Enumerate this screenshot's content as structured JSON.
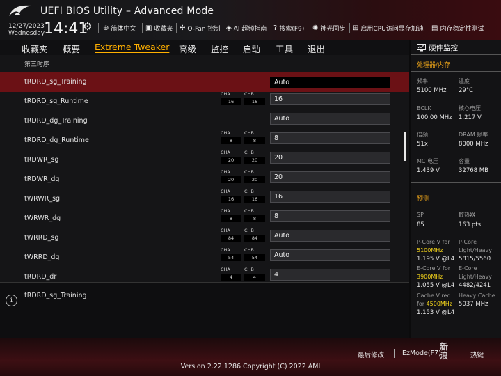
{
  "header": {
    "title": "UEFI BIOS Utility – Advanced Mode",
    "date": "12/27/2023",
    "weekday": "Wednesday",
    "time": "14:41",
    "nav": [
      {
        "label": "简体中文",
        "icon": "globe-icon"
      },
      {
        "label": "收藏夹",
        "icon": "favorites-icon"
      },
      {
        "label": "Q-Fan 控制",
        "icon": "fan-icon"
      },
      {
        "label": "AI 超频指南",
        "icon": "ai-icon"
      },
      {
        "label": "搜索(F9)",
        "icon": "search-icon"
      },
      {
        "label": "神光同步",
        "icon": "aura-icon"
      },
      {
        "label": "启用CPU访问显存加速",
        "icon": "resizable-bar-icon"
      },
      {
        "label": "内存稳定性测试",
        "icon": "memory-test-icon"
      }
    ]
  },
  "menu": {
    "tabs": [
      "收藏夹",
      "概要",
      "Extreme Tweaker",
      "高级",
      "监控",
      "启动",
      "工具",
      "退出"
    ],
    "active": "Extreme Tweaker"
  },
  "main": {
    "section_title": "第三时序",
    "rows": [
      {
        "label": "tRDRD_sg_Training",
        "value": "Auto",
        "cha": "",
        "chb": ""
      },
      {
        "label": "tRDRD_sg_Runtime",
        "value": "16",
        "cha": "16",
        "chb": "16"
      },
      {
        "label": "tRDRD_dg_Training",
        "value": "Auto",
        "cha": "",
        "chb": ""
      },
      {
        "label": "tRDRD_dg_Runtime",
        "value": "8",
        "cha": "8",
        "chb": "8"
      },
      {
        "label": "tRDWR_sg",
        "value": "20",
        "cha": "20",
        "chb": "20"
      },
      {
        "label": "tRDWR_dg",
        "value": "20",
        "cha": "20",
        "chb": "20"
      },
      {
        "label": "tWRWR_sg",
        "value": "16",
        "cha": "16",
        "chb": "16"
      },
      {
        "label": "tWRWR_dg",
        "value": "8",
        "cha": "8",
        "chb": "8"
      },
      {
        "label": "tWRRD_sg",
        "value": "Auto",
        "cha": "84",
        "chb": "84"
      },
      {
        "label": "tWRRD_dg",
        "value": "Auto",
        "cha": "54",
        "chb": "54"
      },
      {
        "label": "tRDRD_dr",
        "value": "4",
        "cha": "4",
        "chb": "4"
      }
    ],
    "cha_label": "CHA",
    "chb_label": "CHB"
  },
  "help": {
    "text": "tRDRD_sg_Training"
  },
  "hw_monitor": {
    "title": "硬件监控",
    "cpu_section": "处理器/内存",
    "freq_label": "频率",
    "freq_value": "5100 MHz",
    "temp_label": "温度",
    "temp_value": "29°C",
    "bclk_label": "BCLK",
    "bclk_value": "100.00 MHz",
    "vcore_label": "核心电压",
    "vcore_value": "1.217 V",
    "ratio_label": "倍频",
    "ratio_value": "51x",
    "dram_label": "DRAM 频率",
    "dram_value": "8000 MHz",
    "mc_label": "MC 电压",
    "mc_value": "1.439 V",
    "cap_label": "容量",
    "cap_value": "32768 MB",
    "predict_section": "预测",
    "sp_label": "SP",
    "sp_value": "85",
    "cool_label": "散热器",
    "cool_value": "163 pts",
    "pcore_label": "P-Core V for",
    "pcore_freq": "5100MHz",
    "pcore_value": "1.195 V @L4",
    "pcore_lh_label": "P-Core\nLight/Heavy",
    "pcore_lh_value": "5815/5560",
    "ecore_label": "E-Core V for",
    "ecore_freq": "3900MHz",
    "ecore_value": "1.055 V @L4",
    "ecore_lh_label": "E-Core\nLight/Heavy",
    "ecore_lh_value": "4482/4241",
    "cache_label": "Cache V req\nfor",
    "cache_freq": "4500MHz",
    "cache_value": "1.153 V @L4",
    "cache_heavy_label": "Heavy Cache",
    "cache_heavy_value": "5037 MHz"
  },
  "footer": {
    "last_modified": "最后修改",
    "ezmode": "EzMode(F7)",
    "hotkeys": "热键",
    "version": "Version 2.22.1286 Copyright (C) 2022 AMI",
    "watermark": "新\n浪"
  },
  "colors": {
    "accent": "#ffb000",
    "selected_row": "#6b1115",
    "highlight": "#f2d21b",
    "section": "#e8a21a"
  }
}
